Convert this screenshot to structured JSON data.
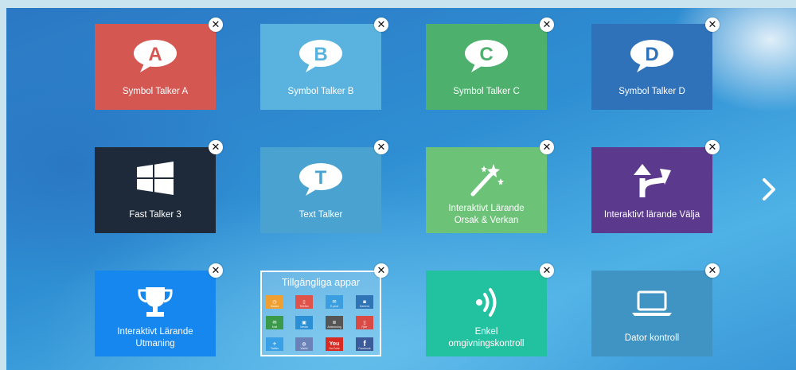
{
  "tiles": [
    {
      "label": "Symbol Talker A",
      "icon": "speech-bubble-a-icon",
      "letter": "A",
      "color": "#d55752"
    },
    {
      "label": "Symbol Talker B",
      "icon": "speech-bubble-b-icon",
      "letter": "B",
      "color": "#5ab3de"
    },
    {
      "label": "Symbol Talker C",
      "icon": "speech-bubble-c-icon",
      "letter": "C",
      "color": "#4db06d"
    },
    {
      "label": "Symbol Talker D",
      "icon": "speech-bubble-d-icon",
      "letter": "D",
      "color": "#2f72b9"
    },
    {
      "label": "Fast Talker 3",
      "icon": "windows-logo-icon",
      "color": "#1e2a3a"
    },
    {
      "label": "Text Talker",
      "icon": "speech-bubble-t-icon",
      "letter": "T",
      "color": "#4aa2d0"
    },
    {
      "label1": "Interaktivt Lärande",
      "label2": "Orsak & Verkan",
      "icon": "magic-wand-icon",
      "color": "#6cc378"
    },
    {
      "label": "Interaktivt lärande Välja",
      "icon": "branch-arrows-icon",
      "color": "#5b3a8e"
    },
    {
      "label1": "Interaktivt Lärande",
      "label2": "Utmaning",
      "icon": "trophy-icon",
      "color": "#1687ee"
    },
    {
      "title": "Tillgängliga appar",
      "apps": [
        {
          "name": "clock-app",
          "sub": "Klocka",
          "color": "#f0a030"
        },
        {
          "name": "phone-app",
          "sub": "Telefon",
          "color": "#e0534b"
        },
        {
          "name": "mail-app",
          "sub": "E-post",
          "color": "#3a9ee0"
        },
        {
          "name": "camera-app",
          "sub": "Kamera",
          "color": "#2f74b5"
        },
        {
          "name": "email-app",
          "sub": "Mail",
          "color": "#3a9a4a"
        },
        {
          "name": "media-app",
          "sub": "Media",
          "color": "#2a8fd4"
        },
        {
          "name": "notes-app",
          "sub": "Anteckning",
          "color": "#555555"
        },
        {
          "name": "remote-app",
          "sub": "Fjärr",
          "color": "#d94a45"
        },
        {
          "name": "twitter-app",
          "sub": "Twitter",
          "color": "#3aa0e5"
        },
        {
          "name": "browser-app",
          "sub": "Webb",
          "color": "#6a82b8"
        },
        {
          "name": "youtube-app",
          "sub": "YouTube",
          "color": "#d62a22",
          "text": "You"
        },
        {
          "name": "facebook-app",
          "sub": "Facebook",
          "color": "#3b5a9a",
          "text": "f"
        }
      ]
    },
    {
      "label1": "Enkel",
      "label2": "omgivningskontroll",
      "icon": "wireless-signal-icon",
      "color": "#22c1a0"
    },
    {
      "label": "Dator kontroll",
      "icon": "laptop-icon",
      "color": "#3f94c4"
    }
  ],
  "close_symbol": "✕",
  "next_icon": "chevron-right-icon"
}
